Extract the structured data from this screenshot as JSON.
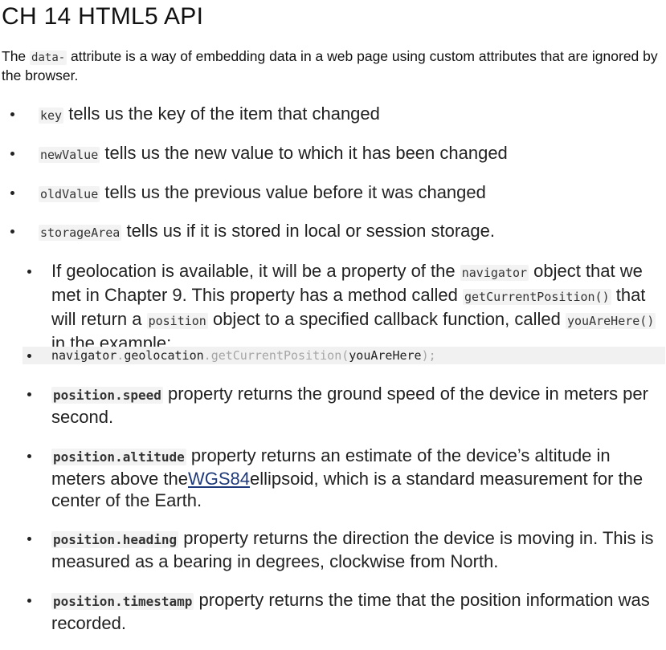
{
  "heading": "CH 14  HTML5 API",
  "intro": {
    "pre": "The ",
    "code": "data-",
    "post": " attribute is a way of embedding data in a web page using custom attributes that are ignored by the browser."
  },
  "storage_event_props": [
    {
      "code": "key",
      "text": " tells us the key of the item that changed"
    },
    {
      "code": "newValue",
      "text": " tells us the new value to which it has been changed"
    },
    {
      "code": "oldValue",
      "text": " tells us the previous value before it was changed"
    },
    {
      "code": "storageArea",
      "text": " tells us if it is stored in local or session storage."
    }
  ],
  "geolocation": {
    "t1": "If geolocation is available, it will be a property of the ",
    "c1": "navigator",
    "t2": " object that we met in Chapter 9. This property has a method called ",
    "c2": "getCurrentPosition()",
    "t3": " that will return a ",
    "c3": "position",
    "t4": " object to a specified callback function, called ",
    "c4": "youAreHere()",
    "t5": " in the example:"
  },
  "code_line": {
    "obj": "navigator",
    "dot1": ".",
    "prop": "geolocation",
    "dot2": ".",
    "method": "getCurrentPosition",
    "open": "(",
    "arg": "youAreHere",
    "close": ");"
  },
  "position_props": {
    "speed": {
      "code": "position.speed",
      "text": " property returns the ground speed of the device in meters per second."
    },
    "altitude": {
      "code": "position.altitude",
      "text_pre": " property returns an estimate of the device’s altitude in meters above the",
      "link": "WGS84",
      "text_post": "ellipsoid, which is a standard measurement for the center of the Earth."
    },
    "heading": {
      "code": "position.heading",
      "text": " property returns the direction the device is moving in. This is measured as a bearing in degrees, clockwise from North."
    },
    "timestamp": {
      "code": "position.timestamp",
      "text": " property returns the time that the position information was recorded."
    }
  }
}
